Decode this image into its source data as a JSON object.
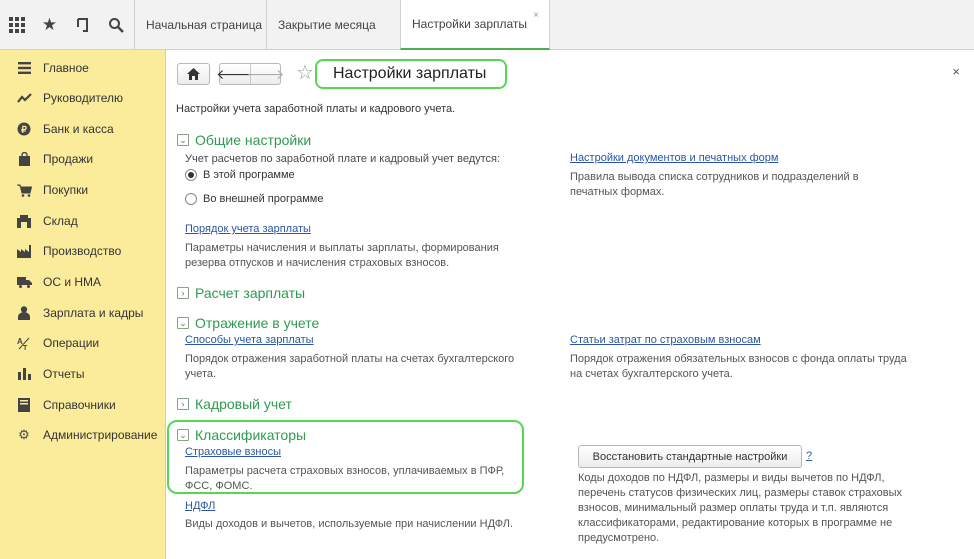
{
  "tabs": [
    {
      "label": "Начальная страница"
    },
    {
      "label": "Закрытие месяца"
    },
    {
      "label": "Настройки зарплаты",
      "close": "×"
    }
  ],
  "sidebar": {
    "items": [
      {
        "label": "Главное",
        "icon": "menu-icon"
      },
      {
        "label": "Руководителю",
        "icon": "trend-icon"
      },
      {
        "label": "Банк и касса",
        "icon": "coin-icon"
      },
      {
        "label": "Продажи",
        "icon": "bag-icon"
      },
      {
        "label": "Покупки",
        "icon": "cart-icon"
      },
      {
        "label": "Склад",
        "icon": "warehouse-icon"
      },
      {
        "label": "Производство",
        "icon": "factory-icon"
      },
      {
        "label": "ОС и НМА",
        "icon": "truck-icon"
      },
      {
        "label": "Зарплата и кадры",
        "icon": "person-icon"
      },
      {
        "label": "Операции",
        "icon": "operations-icon"
      },
      {
        "label": "Отчеты",
        "icon": "bar-chart-icon"
      },
      {
        "label": "Справочники",
        "icon": "book-icon"
      },
      {
        "label": "Администрирование",
        "icon": "gear-icon"
      }
    ]
  },
  "main": {
    "title": "Настройки зарплаты",
    "close": "×",
    "intro": "Настройки учета заработной платы и кадрового учета.",
    "general": {
      "title": "Общие настройки",
      "toggle": "⌄",
      "question": "Учет расчетов по заработной плате и кадровый учет ведутся:",
      "radio_in": "В этой программе",
      "radio_out": "Во внешней программе",
      "order_link": "Порядок учета зарплаты",
      "order_desc_1": "Параметры начисления и выплаты зарплаты, формирования",
      "order_desc_2": "резерва отпусков и начисления страховых взносов.",
      "docs_link": "Настройки документов и печатных форм",
      "docs_desc_1": "Правила вывода списка сотрудников и подразделений в",
      "docs_desc_2": "печатных формах."
    },
    "payroll": {
      "title": "Расчет зарплаты",
      "toggle": "›"
    },
    "accounting": {
      "title": "Отражение в учете",
      "toggle": "⌄",
      "methods_link": "Способы учета зарплаты",
      "methods_desc_1": "Порядок отражения заработной платы на счетах бухгалтерского",
      "methods_desc_2": "учета.",
      "cost_link": "Статьи затрат по страховым взносам",
      "cost_desc_1": "Порядок отражения обязательных взносов с фонда оплаты труда",
      "cost_desc_2": "на счетах бухгалтерского учета."
    },
    "hr": {
      "title": "Кадровый учет",
      "toggle": "›"
    },
    "classifiers": {
      "title": "Классификаторы",
      "toggle": "⌄",
      "ins_link": "Страховые взносы",
      "ins_desc_1": "Параметры расчета страховых взносов, уплачиваемых в ПФР,",
      "ins_desc_2": "ФСС, ФОМС.",
      "ndfl_link": "НДФЛ",
      "ndfl_desc": "Виды доходов и вычетов, используемые при начислении НДФЛ.",
      "restore_button": "Восстановить стандартные настройки",
      "help": "?",
      "restore_desc_1": "Коды доходов по НДФЛ, размеры и виды вычетов по НДФЛ,",
      "restore_desc_2": "перечень статусов физических лиц, размеры ставок страховых",
      "restore_desc_3": "взносов, минимальный размер оплаты труда и т.п. являются",
      "restore_desc_4": "классификаторами, редактирование которых в программе не",
      "restore_desc_5": "предусмотрено."
    }
  }
}
